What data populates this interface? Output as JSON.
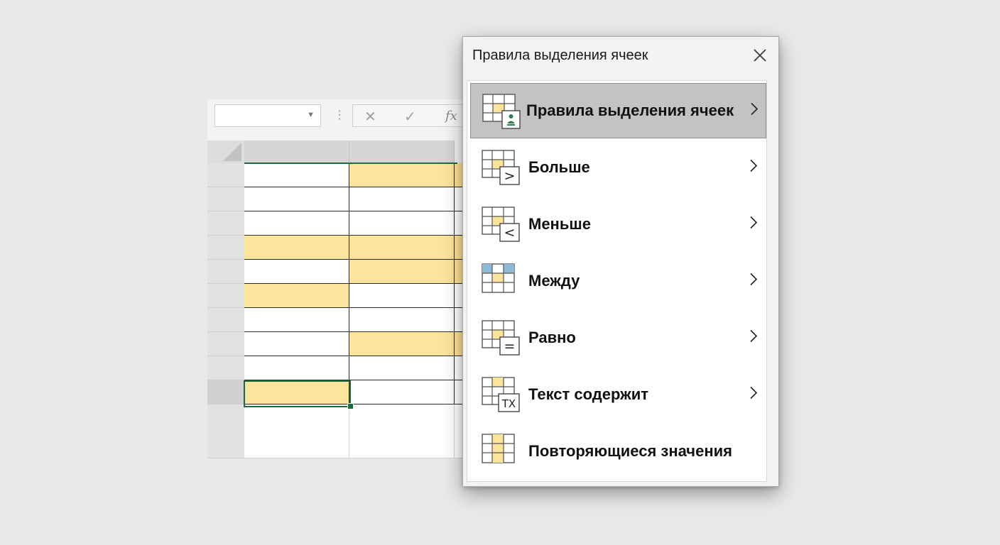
{
  "dialog": {
    "title": "Правила выделения ячеек",
    "close_icon": "close-icon",
    "items": [
      {
        "label": "Правила выделения ячеек",
        "icon": "highlight-rules-icon",
        "has_submenu": true,
        "selected": true
      },
      {
        "label": "Больше",
        "icon": "greater-than-icon",
        "has_submenu": true,
        "selected": false
      },
      {
        "label": "Меньше",
        "icon": "less-than-icon",
        "has_submenu": true,
        "selected": false
      },
      {
        "label": "Между",
        "icon": "between-icon",
        "has_submenu": true,
        "selected": false
      },
      {
        "label": "Равно",
        "icon": "equal-to-icon",
        "has_submenu": true,
        "selected": false
      },
      {
        "label": "Текст содержит",
        "icon": "text-contains-icon",
        "has_submenu": true,
        "selected": false
      },
      {
        "label": "Повторяющиеся значения",
        "icon": "duplicate-values-icon",
        "has_submenu": false,
        "selected": false
      }
    ],
    "icon_glyphs": {
      "greater": ">",
      "less": "<",
      "equal": "=",
      "text": "TX"
    }
  },
  "formula_bar": {
    "name_box_value": "",
    "cancel_glyph": "✕",
    "enter_glyph": "✓",
    "fx_label": "fx",
    "separator": "⋮"
  },
  "colors": {
    "highlight_fill": "#fde49c",
    "selection_border": "#1e6b3e",
    "dialog_selected": "#c3c3c3",
    "between_header_blue": "#8fb9d9"
  }
}
